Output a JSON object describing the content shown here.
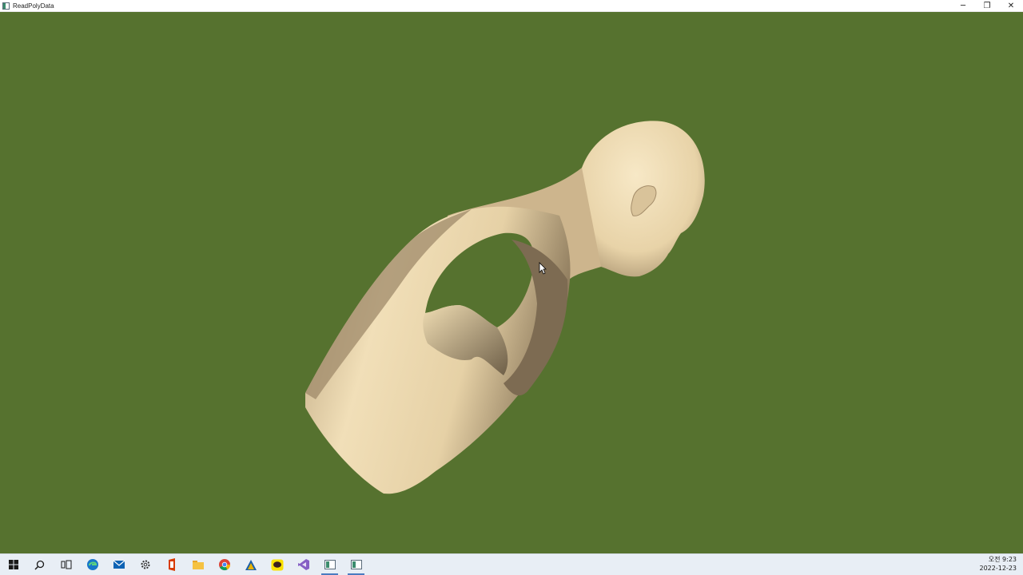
{
  "window": {
    "title": "ReadPolyData",
    "background_color": "#56722f",
    "controls": {
      "minimize": "─",
      "restore": "❐",
      "close": "✕"
    }
  },
  "viewport": {
    "model_color": "#ecd9b0",
    "content": "3d-head-torso-mesh"
  },
  "taskbar": {
    "items": [
      {
        "name": "start-icon"
      },
      {
        "name": "search-icon"
      },
      {
        "name": "task-view-icon"
      },
      {
        "name": "edge-icon"
      },
      {
        "name": "mail-icon"
      },
      {
        "name": "settings-icon"
      },
      {
        "name": "office-icon"
      },
      {
        "name": "file-explorer-icon"
      },
      {
        "name": "chrome-icon"
      },
      {
        "name": "autodesk-icon"
      },
      {
        "name": "kakaotalk-icon"
      },
      {
        "name": "visual-studio-icon"
      },
      {
        "name": "app-window-icon"
      },
      {
        "name": "app-window-active-icon"
      }
    ],
    "clock": {
      "time": "오전 9:23",
      "date": "2022-12-23"
    }
  }
}
